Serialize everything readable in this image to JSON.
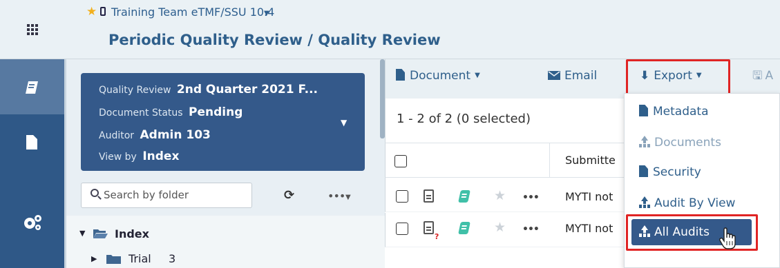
{
  "header": {
    "vault_name": "Training Team eTMF/SSU 10.4",
    "page_title": "Periodic Quality Review / Quality Review"
  },
  "rail": {
    "items": [
      "book-icon",
      "file-icon",
      "gears-icon"
    ]
  },
  "review_card": {
    "quality_review_label": "Quality Review",
    "quality_review_value": "2nd Quarter 2021 F...",
    "document_status_label": "Document Status",
    "document_status_value": "Pending",
    "auditor_label": "Auditor",
    "auditor_value": "Admin 103",
    "view_by_label": "View by",
    "view_by_value": "Index"
  },
  "folder_search": {
    "placeholder": "Search by folder"
  },
  "tree": {
    "root_label": "Index",
    "child_label": "Trial",
    "child_count": "3"
  },
  "toolbar": {
    "document_label": "Document",
    "email_label": "Email",
    "export_label": "Export",
    "truncated_label": "A"
  },
  "results": {
    "count_text": "1 - 2 of 2 (0 selected)",
    "col_submitted": "Submitte",
    "rows": [
      {
        "submitted": "MYTI not"
      },
      {
        "submitted": "MYTI not"
      }
    ]
  },
  "export_menu": {
    "items": [
      {
        "label": "Metadata",
        "icon": "file-icon",
        "enabled": true
      },
      {
        "label": "Documents",
        "icon": "upload-icon",
        "enabled": false
      },
      {
        "label": "Security",
        "icon": "file-icon",
        "enabled": true
      },
      {
        "label": "Audit By View",
        "icon": "upload-icon",
        "enabled": true
      },
      {
        "label": "All Audits",
        "icon": "upload-icon",
        "enabled": true,
        "selected": true
      }
    ]
  },
  "colors": {
    "brand_blue": "#2f5887",
    "card_blue": "#34598a",
    "highlight_red": "#e02424",
    "star_gold": "#f2b01e",
    "book_teal": "#40c0a8"
  }
}
